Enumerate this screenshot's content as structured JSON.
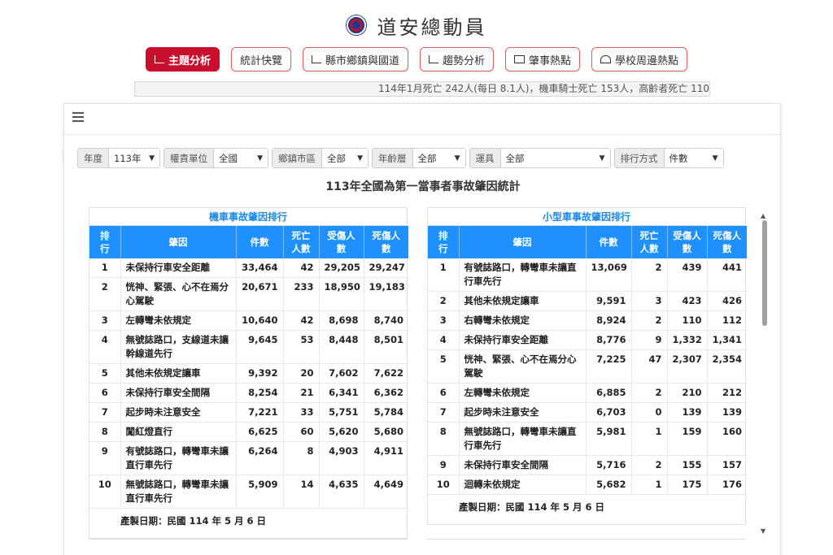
{
  "header": {
    "title": "道安總動員"
  },
  "nav": [
    {
      "label": "主題分析",
      "icon": "area-chart-icon",
      "active": true
    },
    {
      "label": "統計快覽",
      "icon": "card-icon",
      "active": false
    },
    {
      "label": "縣市鄉鎮與國道",
      "icon": "bar-chart-icon",
      "active": false
    },
    {
      "label": "趨勢分析",
      "icon": "area-chart-icon",
      "active": false
    },
    {
      "label": "肇事熱點",
      "icon": "map-icon",
      "active": false
    },
    {
      "label": "學校周邊熱點",
      "icon": "school-icon",
      "active": false
    }
  ],
  "ticker": {
    "text": "114年1月死亡 242人(每日 8.1人)，機車騎士死亡 153人，高齡者死亡 110"
  },
  "filters": [
    {
      "label": "年度",
      "value": "113年"
    },
    {
      "label": "權責單位",
      "value": "全國"
    },
    {
      "label": "鄉鎮市區",
      "value": "全部"
    },
    {
      "label": "年齡層",
      "value": "全部"
    },
    {
      "label": "運具",
      "value": "全部"
    },
    {
      "label": "排行方式",
      "value": "件數"
    }
  ],
  "report_title": "113年全國為第一當事者事故肇因統計",
  "columns": {
    "rank": "排行",
    "cause": "肇因",
    "count": "件數",
    "deaths": "死亡人數",
    "injured": "受傷人數",
    "casualties": "死傷人數"
  },
  "tables": {
    "left": {
      "title": "機車事故肇因排行",
      "rows": [
        {
          "rank": "1",
          "cause": "未保持行車安全距離",
          "count": "33,464",
          "deaths": "42",
          "injured": "29,205",
          "casualties": "29,247"
        },
        {
          "rank": "2",
          "cause": "恍神、緊張、心不在焉分心駕駛",
          "count": "20,671",
          "deaths": "233",
          "injured": "18,950",
          "casualties": "19,183"
        },
        {
          "rank": "3",
          "cause": "左轉彎未依規定",
          "count": "10,640",
          "deaths": "42",
          "injured": "8,698",
          "casualties": "8,740"
        },
        {
          "rank": "4",
          "cause": "無號誌路口，支線道未讓幹線道先行",
          "count": "9,645",
          "deaths": "53",
          "injured": "8,448",
          "casualties": "8,501"
        },
        {
          "rank": "5",
          "cause": "其他未依規定讓車",
          "count": "9,392",
          "deaths": "20",
          "injured": "7,602",
          "casualties": "7,622"
        },
        {
          "rank": "6",
          "cause": "未保持行車安全間隔",
          "count": "8,254",
          "deaths": "21",
          "injured": "6,341",
          "casualties": "6,362"
        },
        {
          "rank": "7",
          "cause": "起步時未注意安全",
          "count": "7,221",
          "deaths": "33",
          "injured": "5,751",
          "casualties": "5,784"
        },
        {
          "rank": "8",
          "cause": "闖紅燈直行",
          "count": "6,625",
          "deaths": "60",
          "injured": "5,620",
          "casualties": "5,680"
        },
        {
          "rank": "9",
          "cause": "有號誌路口，轉彎車未讓直行車先行",
          "count": "6,264",
          "deaths": "8",
          "injured": "4,903",
          "casualties": "4,911"
        },
        {
          "rank": "10",
          "cause": "無號誌路口，轉彎車未讓直行車先行",
          "count": "5,909",
          "deaths": "14",
          "injured": "4,635",
          "casualties": "4,649"
        }
      ],
      "footer": "產製日期：民國 114 年 5 月 6 日"
    },
    "right": {
      "title": "小型車事故肇因排行",
      "rows": [
        {
          "rank": "1",
          "cause": "有號誌路口，轉彎車未讓直行車先行",
          "count": "13,069",
          "deaths": "2",
          "injured": "439",
          "casualties": "441"
        },
        {
          "rank": "2",
          "cause": "其他未依規定讓車",
          "count": "9,591",
          "deaths": "3",
          "injured": "423",
          "casualties": "426"
        },
        {
          "rank": "3",
          "cause": "右轉彎未依規定",
          "count": "8,924",
          "deaths": "2",
          "injured": "110",
          "casualties": "112"
        },
        {
          "rank": "4",
          "cause": "未保持行車安全距離",
          "count": "8,776",
          "deaths": "9",
          "injured": "1,332",
          "casualties": "1,341"
        },
        {
          "rank": "5",
          "cause": "恍神、緊張、心不在焉分心駕駛",
          "count": "7,225",
          "deaths": "47",
          "injured": "2,307",
          "casualties": "2,354"
        },
        {
          "rank": "6",
          "cause": "左轉彎未依規定",
          "count": "6,885",
          "deaths": "2",
          "injured": "210",
          "casualties": "212"
        },
        {
          "rank": "7",
          "cause": "起步時未注意安全",
          "count": "6,703",
          "deaths": "0",
          "injured": "139",
          "casualties": "139"
        },
        {
          "rank": "8",
          "cause": "無號誌路口，轉彎車未讓直行車先行",
          "count": "5,981",
          "deaths": "1",
          "injured": "159",
          "casualties": "160"
        },
        {
          "rank": "9",
          "cause": "未保持行車安全間隔",
          "count": "5,716",
          "deaths": "2",
          "injured": "155",
          "casualties": "157"
        },
        {
          "rank": "10",
          "cause": "迴轉未依規定",
          "count": "5,682",
          "deaths": "1",
          "injured": "175",
          "casualties": "176"
        }
      ],
      "footer": "產製日期：民國 114 年 5 月 6 日"
    }
  },
  "colors": {
    "brand_red": "#c8102e",
    "table_header_blue": "#1e90ff",
    "panel_title_blue": "#1e88e5"
  }
}
